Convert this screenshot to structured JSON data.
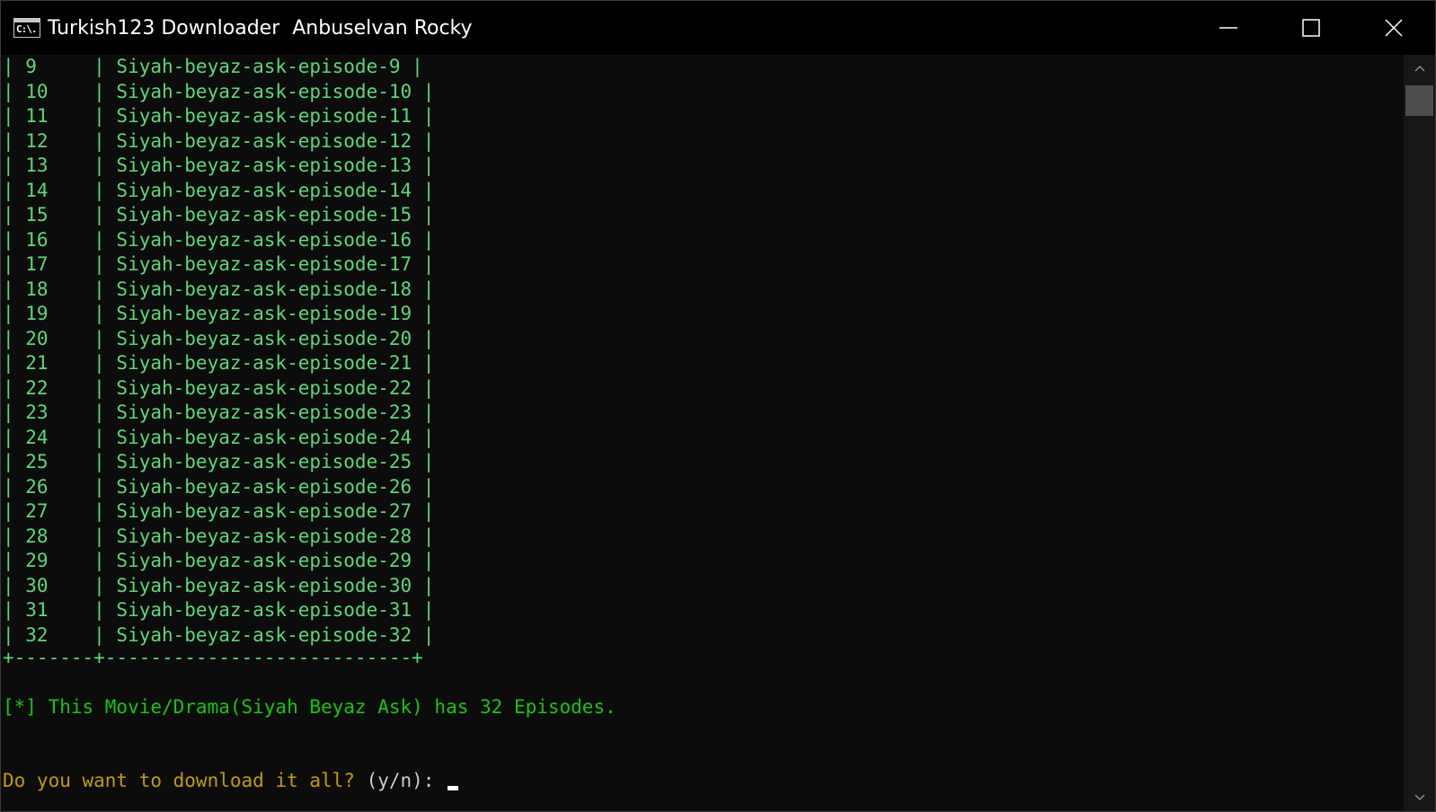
{
  "window": {
    "title": "Turkish123 Downloader  Anbuselvan Rocky",
    "app_icon_text": "C:\\.",
    "controls": [
      "minimize-icon",
      "maximize-icon",
      "close-icon"
    ]
  },
  "terminal": {
    "table_rows": [
      {
        "num": "9",
        "name": "Siyah-beyaz-ask-episode-9"
      },
      {
        "num": "10",
        "name": "Siyah-beyaz-ask-episode-10"
      },
      {
        "num": "11",
        "name": "Siyah-beyaz-ask-episode-11"
      },
      {
        "num": "12",
        "name": "Siyah-beyaz-ask-episode-12"
      },
      {
        "num": "13",
        "name": "Siyah-beyaz-ask-episode-13"
      },
      {
        "num": "14",
        "name": "Siyah-beyaz-ask-episode-14"
      },
      {
        "num": "15",
        "name": "Siyah-beyaz-ask-episode-15"
      },
      {
        "num": "16",
        "name": "Siyah-beyaz-ask-episode-16"
      },
      {
        "num": "17",
        "name": "Siyah-beyaz-ask-episode-17"
      },
      {
        "num": "18",
        "name": "Siyah-beyaz-ask-episode-18"
      },
      {
        "num": "19",
        "name": "Siyah-beyaz-ask-episode-19"
      },
      {
        "num": "20",
        "name": "Siyah-beyaz-ask-episode-20"
      },
      {
        "num": "21",
        "name": "Siyah-beyaz-ask-episode-21"
      },
      {
        "num": "22",
        "name": "Siyah-beyaz-ask-episode-22"
      },
      {
        "num": "23",
        "name": "Siyah-beyaz-ask-episode-23"
      },
      {
        "num": "24",
        "name": "Siyah-beyaz-ask-episode-24"
      },
      {
        "num": "25",
        "name": "Siyah-beyaz-ask-episode-25"
      },
      {
        "num": "26",
        "name": "Siyah-beyaz-ask-episode-26"
      },
      {
        "num": "27",
        "name": "Siyah-beyaz-ask-episode-27"
      },
      {
        "num": "28",
        "name": "Siyah-beyaz-ask-episode-28"
      },
      {
        "num": "29",
        "name": "Siyah-beyaz-ask-episode-29"
      },
      {
        "num": "30",
        "name": "Siyah-beyaz-ask-episode-30"
      },
      {
        "num": "31",
        "name": "Siyah-beyaz-ask-episode-31"
      },
      {
        "num": "32",
        "name": "Siyah-beyaz-ask-episode-32"
      }
    ],
    "table_border": "+-------+---------------------------+",
    "info_line": "[*] This Movie/Drama(Siyah Beyaz Ask) has 32 Episodes.",
    "prompt_text": "Do you want to download it all? ",
    "prompt_options": "(y/n):",
    "input_value": ""
  },
  "colors": {
    "background": "#0c0c0c",
    "table_text": "#5bd879",
    "info_text": "#16c60c",
    "prompt_text": "#c19c00",
    "prompt_options": "#cccccc"
  },
  "scrollbar": {
    "up_icon": "chevron-up-icon",
    "down_icon": "chevron-down-icon"
  }
}
